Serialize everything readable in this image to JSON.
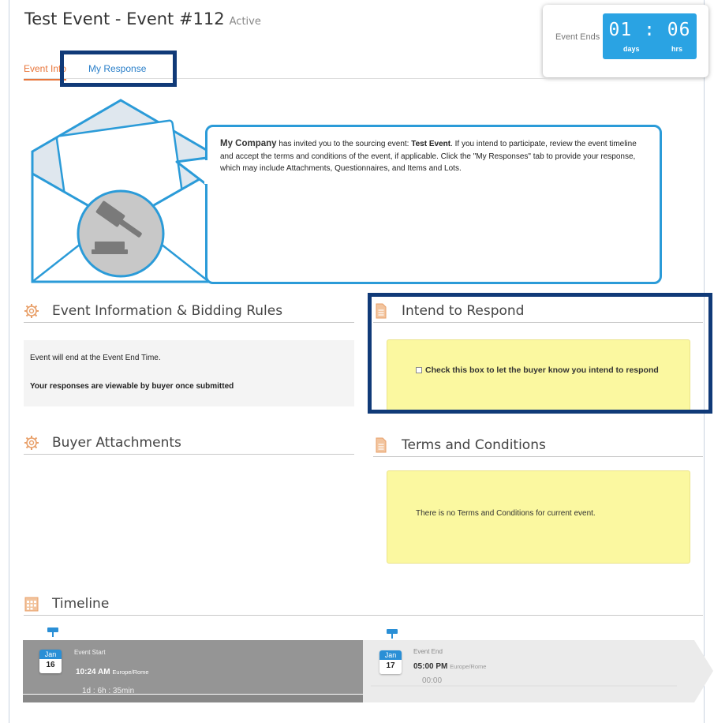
{
  "header": {
    "title": "Test Event - Event #112",
    "status": "Active"
  },
  "timer": {
    "label": "Event Ends",
    "value": "01 : 06",
    "unit_days": "days",
    "unit_hrs": "hrs"
  },
  "tabs": [
    {
      "label": "Event Info",
      "active": true
    },
    {
      "label": "My Response",
      "active": false
    }
  ],
  "invitation": {
    "company": "My Company",
    "text_before": " has invited you to the sourcing event: ",
    "event_name": "Test Event",
    "text_after": ". If you intend to participate, review the event timeline and accept the terms and conditions of the event, if applicable. Click the \"My Responses\" tab to provide your response, which may include Attachments, Questionnaires, and Items and Lots."
  },
  "sections": {
    "event_info": {
      "title": "Event Information & Bidding Rules",
      "line1": "Event will end at the Event End Time.",
      "line2": "Your responses are viewable by buyer once submitted"
    },
    "intend": {
      "title": "Intend to Respond",
      "checkbox_label": "Check this box to let the buyer know you intend to respond"
    },
    "attachments": {
      "title": "Buyer Attachments"
    },
    "terms": {
      "title": "Terms and Conditions",
      "text": "There is no Terms and Conditions for current event."
    },
    "timeline": {
      "title": "Timeline",
      "start": {
        "label": "Event Start",
        "month": "Jan",
        "day": "16",
        "time": "10:24 AM",
        "tz": "Europe/Rome",
        "duration": "1d : 6h : 35min"
      },
      "end": {
        "label": "Event End",
        "month": "Jan",
        "day": "17",
        "time": "05:00 PM",
        "tz": "Europe/Rome",
        "duration": "00:00"
      }
    }
  },
  "colors": {
    "accent_orange": "#e8753a",
    "link_blue": "#2a7fc9",
    "timer_blue": "#2aa3e3",
    "highlight_navy": "#103a78",
    "note_yellow": "#fbf8a0"
  },
  "icons": [
    "gavel-icon",
    "gear-icon",
    "document-icon",
    "calendar-icon",
    "pin-icon"
  ]
}
